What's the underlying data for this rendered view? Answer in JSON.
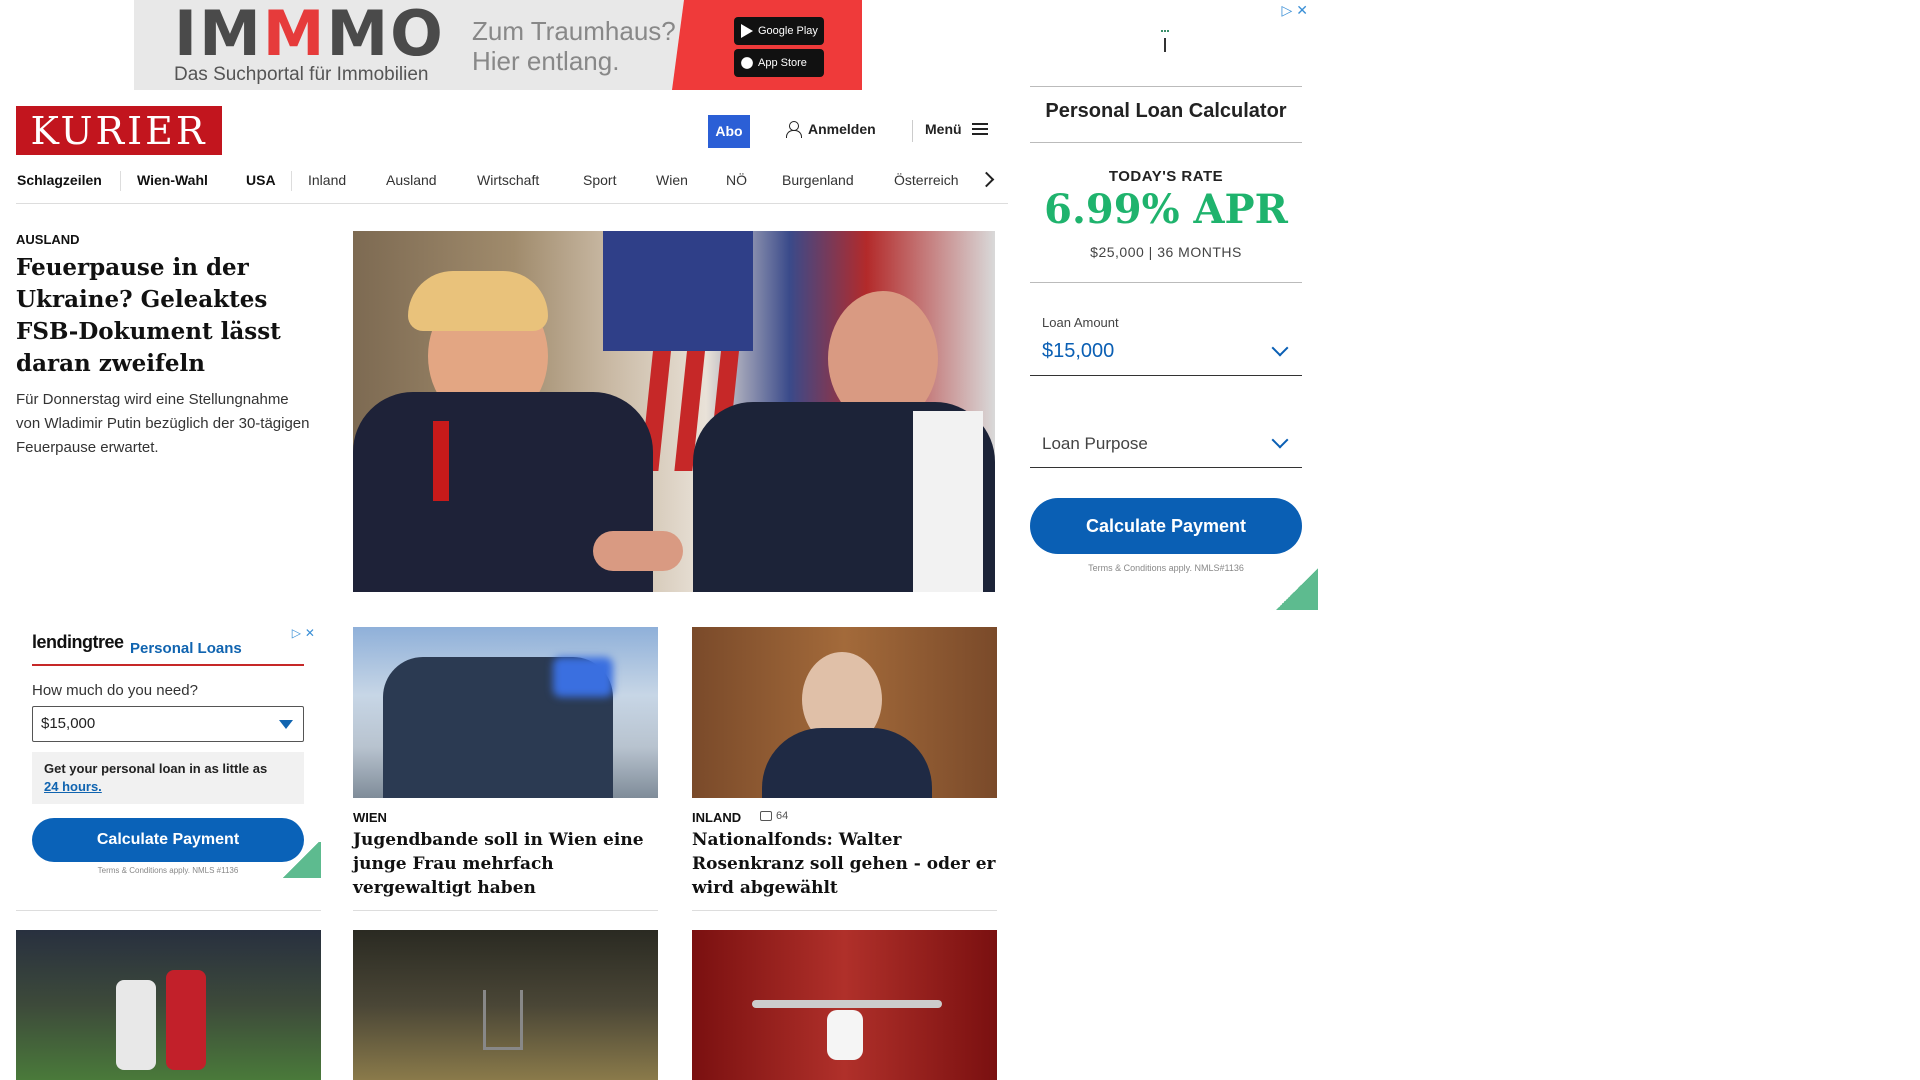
{
  "top_ad": {
    "brand_pre": "IM",
    "brand_accent": "M",
    "brand_post": "MO",
    "tagline": "Das Suchportal für Immobilien",
    "slogan_line1": "Zum Traumhaus?",
    "slogan_line2": "Hier entlang.",
    "google_play": "Google Play",
    "app_store": "App Store",
    "brand_color": "#e63b3b"
  },
  "header": {
    "logo": "KURIER",
    "abo": "Abo",
    "login": "Anmelden",
    "menu": "Menü",
    "logo_color": "#c2151e",
    "abo_color": "#2b5fd6"
  },
  "nav": {
    "items": [
      "Schlagzeilen",
      "Wien-Wahl",
      "USA",
      "Inland",
      "Ausland",
      "Wirtschaft",
      "Sport",
      "Wien",
      "NÖ",
      "Burgenland",
      "Österreich"
    ]
  },
  "lead": {
    "kicker": "AUSLAND",
    "title": "Feuerpause in der Ukraine? Geleaktes FSB-Dokument lässt daran zweifeln",
    "teaser": "Für Donnerstag wird eine Stellungnahme von Wladimir Putin bezüglich der 30-tägigen Feuerpause erwartet."
  },
  "left_ad": {
    "logo": "lendingtree",
    "product": "Personal Loans",
    "question": "How much do you need?",
    "amount": "$15,000",
    "info_text": "Get your personal loan in as little as",
    "info_link": "24 hours.",
    "cta": "Calculate Payment",
    "terms": "Terms & Conditions apply. NMLS #1136"
  },
  "cards": [
    {
      "kicker": "WIEN",
      "title": "Jugendbande soll in Wien eine junge Frau mehrfach vergewaltigt haben",
      "comments": ""
    },
    {
      "kicker": "INLAND",
      "title": "Nationalfonds: Walter Rosenkranz soll gehen - oder er wird abgewählt",
      "comments": "64"
    }
  ],
  "right_ad": {
    "title": "Personal Loan Calculator",
    "rate_label": "TODAY'S RATE",
    "rate": "6.99% APR",
    "rate_sub": "$25,000 | 36 MONTHS",
    "amount_label": "Loan Amount",
    "amount": "$15,000",
    "purpose": "Loan Purpose",
    "cta": "Calculate Payment",
    "terms": "Terms & Conditions apply. NMLS#1136",
    "rate_color": "#1fb36d"
  }
}
